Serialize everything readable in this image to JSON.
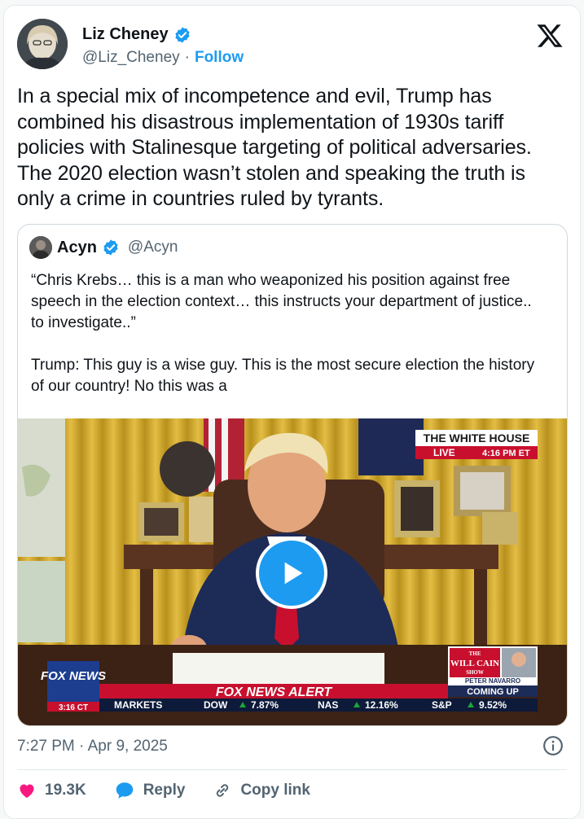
{
  "author": {
    "name": "Liz Cheney",
    "handle": "@Liz_Cheney",
    "separator": "·",
    "follow_label": "Follow"
  },
  "tweet_text": "In a special mix of incompetence and evil, Trump has combined his disastrous implementation of 1930s tariff policies with Stalinesque targeting of political adversaries. The 2020 election wasn’t stolen and speaking the truth is only a crime in countries ruled by tyrants.",
  "quoted": {
    "name": "Acyn",
    "handle": "@Acyn",
    "text": "“Chris Krebs… this is a man who weaponized his position against free speech in the election context… this instructs your department of justice.. to investigate..”\n\nTrump: This guy is a wise guy. This is the most secure election the history of our country! No this was a",
    "video": {
      "banner_live_title": "THE WHITE HOUSE",
      "banner_live": "LIVE",
      "banner_time": "4:16 PM ET",
      "network": "FOX NEWS",
      "network_time": "3:16 CT",
      "alert": "FOX NEWS ALERT",
      "markets_label": "MARKETS",
      "tickers": [
        {
          "name": "DOW",
          "value": "7.87%"
        },
        {
          "name": "NAS",
          "value": "12.16%"
        },
        {
          "name": "S&P",
          "value": "9.52%"
        }
      ],
      "show_name_top": "THE",
      "show_name": "WILL CAIN",
      "show_name_bottom": "SHOW",
      "guest": "PETER NAVARRO",
      "coming_up": "COMING UP"
    }
  },
  "timestamp": "7:27 PM · Apr 9, 2025",
  "actions": {
    "likes": "19.3K",
    "reply_label": "Reply",
    "copy_label": "Copy link"
  },
  "colors": {
    "accent": "#1d9bf0",
    "like": "#f91880",
    "fox_red": "#c8102e",
    "ticker_green": "#18a63a"
  },
  "icons": [
    "verified-badge-icon",
    "x-logo-icon",
    "play-icon",
    "info-icon",
    "heart-icon",
    "reply-icon",
    "link-icon"
  ]
}
